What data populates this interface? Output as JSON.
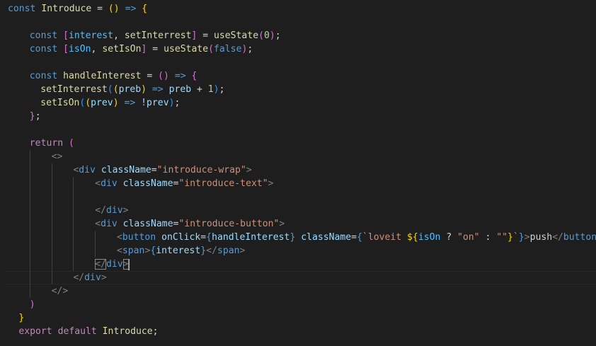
{
  "editor": {
    "theme": "dark",
    "background": "#1e1e1e",
    "cursor_line": 20,
    "lines": [
      {
        "indent": 0,
        "guides": [],
        "tokens": [
          {
            "t": "const",
            "c": "storage"
          },
          {
            "t": " "
          },
          {
            "t": "Introduce",
            "c": "func"
          },
          {
            "t": " = "
          },
          {
            "t": "()",
            "c": "b1"
          },
          {
            "t": " "
          },
          {
            "t": "=>",
            "c": "storage"
          },
          {
            "t": " "
          },
          {
            "t": "{",
            "c": "b1"
          }
        ]
      },
      {
        "indent": 0,
        "guides": [],
        "tokens": []
      },
      {
        "indent": 4,
        "guides": [],
        "tokens": [
          {
            "t": "const",
            "c": "storage"
          },
          {
            "t": " "
          },
          {
            "t": "[",
            "c": "b2"
          },
          {
            "t": "interest",
            "c": "const"
          },
          {
            "t": ", "
          },
          {
            "t": "setInterrest",
            "c": "func"
          },
          {
            "t": "]",
            "c": "b2"
          },
          {
            "t": " = "
          },
          {
            "t": "useState",
            "c": "func"
          },
          {
            "t": "(",
            "c": "b2"
          },
          {
            "t": "0",
            "c": "num"
          },
          {
            "t": ")",
            "c": "b2"
          },
          {
            "t": ";"
          }
        ]
      },
      {
        "indent": 4,
        "guides": [],
        "tokens": [
          {
            "t": "const",
            "c": "storage"
          },
          {
            "t": " "
          },
          {
            "t": "[",
            "c": "b2"
          },
          {
            "t": "isOn",
            "c": "const"
          },
          {
            "t": ", "
          },
          {
            "t": "setIsOn",
            "c": "func"
          },
          {
            "t": "]",
            "c": "b2"
          },
          {
            "t": " = "
          },
          {
            "t": "useState",
            "c": "func"
          },
          {
            "t": "(",
            "c": "b2"
          },
          {
            "t": "false",
            "c": "storage"
          },
          {
            "t": ")",
            "c": "b2"
          },
          {
            "t": ";"
          }
        ]
      },
      {
        "indent": 0,
        "guides": [],
        "tokens": []
      },
      {
        "indent": 4,
        "guides": [],
        "tokens": [
          {
            "t": "const",
            "c": "storage"
          },
          {
            "t": " "
          },
          {
            "t": "handleInterest",
            "c": "func"
          },
          {
            "t": " = "
          },
          {
            "t": "()",
            "c": "b2"
          },
          {
            "t": " "
          },
          {
            "t": "=>",
            "c": "storage"
          },
          {
            "t": " "
          },
          {
            "t": "{",
            "c": "b2"
          }
        ]
      },
      {
        "indent": 6,
        "guides": [],
        "tokens": [
          {
            "t": "setInterrest",
            "c": "func"
          },
          {
            "t": "(",
            "c": "b3"
          },
          {
            "t": "(",
            "c": "b1"
          },
          {
            "t": "preb",
            "c": "var"
          },
          {
            "t": ")",
            "c": "b1"
          },
          {
            "t": " "
          },
          {
            "t": "=>",
            "c": "storage"
          },
          {
            "t": " "
          },
          {
            "t": "preb",
            "c": "var"
          },
          {
            "t": " + "
          },
          {
            "t": "1",
            "c": "num"
          },
          {
            "t": ")",
            "c": "b3"
          },
          {
            "t": ";"
          }
        ]
      },
      {
        "indent": 6,
        "guides": [],
        "tokens": [
          {
            "t": "setIsOn",
            "c": "func"
          },
          {
            "t": "(",
            "c": "b3"
          },
          {
            "t": "(",
            "c": "b1"
          },
          {
            "t": "prev",
            "c": "var"
          },
          {
            "t": ")",
            "c": "b1"
          },
          {
            "t": " "
          },
          {
            "t": "=>",
            "c": "storage"
          },
          {
            "t": " "
          },
          {
            "t": "!prev",
            "c": "var"
          },
          {
            "t": ")",
            "c": "b3"
          },
          {
            "t": ";"
          }
        ]
      },
      {
        "indent": 4,
        "guides": [],
        "tokens": [
          {
            "t": "}",
            "c": "b2"
          },
          {
            "t": ";"
          }
        ]
      },
      {
        "indent": 0,
        "guides": [],
        "tokens": []
      },
      {
        "indent": 4,
        "guides": [],
        "tokens": [
          {
            "t": "return",
            "c": "keyword"
          },
          {
            "t": " "
          },
          {
            "t": "(",
            "c": "b2"
          }
        ]
      },
      {
        "indent": 8,
        "guides": [
          4
        ],
        "tokens": [
          {
            "t": "<>",
            "c": "punct"
          }
        ]
      },
      {
        "indent": 12,
        "guides": [
          4,
          8
        ],
        "tokens": [
          {
            "t": "<",
            "c": "punct"
          },
          {
            "t": "div",
            "c": "tag"
          },
          {
            "t": " "
          },
          {
            "t": "className",
            "c": "attr"
          },
          {
            "t": "="
          },
          {
            "t": "\"introduce-wrap\"",
            "c": "str"
          },
          {
            "t": ">",
            "c": "punct"
          }
        ]
      },
      {
        "indent": 16,
        "guides": [
          4,
          8,
          12
        ],
        "tokens": [
          {
            "t": "<",
            "c": "punct"
          },
          {
            "t": "div",
            "c": "tag"
          },
          {
            "t": " "
          },
          {
            "t": "className",
            "c": "attr"
          },
          {
            "t": "="
          },
          {
            "t": "\"introduce-text\"",
            "c": "str"
          },
          {
            "t": ">",
            "c": "punct"
          }
        ]
      },
      {
        "indent": 0,
        "guides": [
          4,
          8,
          12
        ],
        "tokens": []
      },
      {
        "indent": 16,
        "guides": [
          4,
          8,
          12
        ],
        "tokens": [
          {
            "t": "</",
            "c": "punct"
          },
          {
            "t": "div",
            "c": "tag"
          },
          {
            "t": ">",
            "c": "punct"
          }
        ]
      },
      {
        "indent": 16,
        "guides": [
          4,
          8,
          12
        ],
        "tokens": [
          {
            "t": "<",
            "c": "punct"
          },
          {
            "t": "div",
            "c": "tag"
          },
          {
            "t": " "
          },
          {
            "t": "className",
            "c": "attr"
          },
          {
            "t": "="
          },
          {
            "t": "\"introduce-button\"",
            "c": "str"
          },
          {
            "t": ">",
            "c": "punct"
          }
        ]
      },
      {
        "indent": 20,
        "guides": [
          4,
          8,
          12,
          16
        ],
        "tokens": [
          {
            "t": "<",
            "c": "punct"
          },
          {
            "t": "button",
            "c": "tag"
          },
          {
            "t": " "
          },
          {
            "t": "onClick",
            "c": "attr"
          },
          {
            "t": "="
          },
          {
            "t": "{",
            "c": "tpl"
          },
          {
            "t": "handleInterest",
            "c": "var"
          },
          {
            "t": "}",
            "c": "tpl"
          },
          {
            "t": " "
          },
          {
            "t": "className",
            "c": "attr"
          },
          {
            "t": "="
          },
          {
            "t": "{",
            "c": "tpl"
          },
          {
            "t": "`loveit ",
            "c": "str"
          },
          {
            "t": "${",
            "c": "b1"
          },
          {
            "t": "isOn",
            "c": "const"
          },
          {
            "t": " ? "
          },
          {
            "t": "\"on\"",
            "c": "str"
          },
          {
            "t": " : "
          },
          {
            "t": "\"\"",
            "c": "str"
          },
          {
            "t": "}",
            "c": "b1"
          },
          {
            "t": "`",
            "c": "str"
          },
          {
            "t": "}",
            "c": "tpl"
          },
          {
            "t": ">",
            "c": "punct"
          },
          {
            "t": "push",
            "c": "text"
          },
          {
            "t": "</",
            "c": "punct"
          },
          {
            "t": "button",
            "c": "tag"
          },
          {
            "t": ">",
            "c": "punct"
          }
        ]
      },
      {
        "indent": 20,
        "guides": [
          4,
          8,
          12,
          16
        ],
        "tokens": [
          {
            "t": "<",
            "c": "punct"
          },
          {
            "t": "span",
            "c": "tag"
          },
          {
            "t": ">",
            "c": "punct"
          },
          {
            "t": "{",
            "c": "tpl"
          },
          {
            "t": "interest",
            "c": "var"
          },
          {
            "t": "}",
            "c": "tpl"
          },
          {
            "t": "</",
            "c": "punct"
          },
          {
            "t": "span",
            "c": "tag"
          },
          {
            "t": ">",
            "c": "punct"
          }
        ]
      },
      {
        "indent": 16,
        "guides": [
          4,
          8,
          12
        ],
        "tokens": [
          {
            "t": "</",
            "c": "punct",
            "m": 1
          },
          {
            "t": "div",
            "c": "tag"
          },
          {
            "t": ">",
            "c": "punct",
            "m": 1,
            "cur": 1
          }
        ]
      },
      {
        "indent": 12,
        "guides": [
          4,
          8
        ],
        "tokens": [
          {
            "t": "</",
            "c": "punct"
          },
          {
            "t": "div",
            "c": "tag"
          },
          {
            "t": ">",
            "c": "punct"
          }
        ]
      },
      {
        "indent": 8,
        "guides": [
          4
        ],
        "tokens": [
          {
            "t": "</>",
            "c": "punct"
          }
        ]
      },
      {
        "indent": 4,
        "guides": [],
        "tokens": [
          {
            "t": ")",
            "c": "b2"
          }
        ]
      },
      {
        "indent": 2,
        "guides": [],
        "tokens": [
          {
            "t": "}",
            "c": "b1"
          }
        ]
      },
      {
        "indent": 2,
        "guides": [],
        "tokens": [
          {
            "t": "export",
            "c": "keyword"
          },
          {
            "t": " "
          },
          {
            "t": "default",
            "c": "keyword"
          },
          {
            "t": " "
          },
          {
            "t": "Introduce",
            "c": "func"
          },
          {
            "t": ";"
          }
        ]
      }
    ]
  }
}
